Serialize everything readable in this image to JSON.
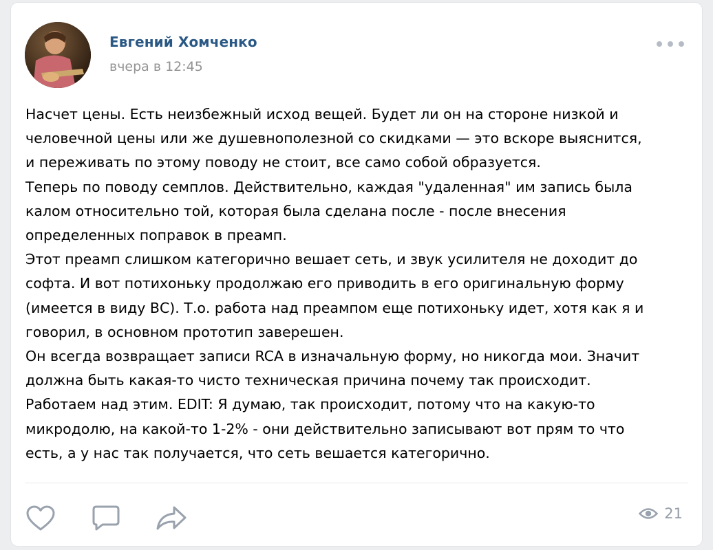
{
  "post": {
    "author": "Евгений Хомченко",
    "time": "вчера в 12:45",
    "lines": [
      "Насчет цены. Есть неизбежный исход вещей. Будет ли он на стороне низкой и",
      "человечной цены или же душевнополезной со скидками — это вскоре выяснится,",
      "и переживать по этому поводу не стоит, все само собой образуется.",
      "Теперь по поводу семплов. Действительно, каждая \"удаленная\" им запись была",
      "калом относительно той, которая была сделана после - после внесения",
      "определенных поправок в преамп.",
      "Этот преамп слишком категорично вешает сеть, и звук усилителя не доходит до",
      "софта. И вот потихоньку продолжаю его приводить в его оригинальную форму",
      "(имеется в виду ВС). Т.о. работа над преампом еще потихоньку идет, хотя как я и",
      "говорил, в основном прототип заверешен.",
      "Он всегда возвращает записи RCA в изначальную форму, но никогда мои. Значит",
      "должна быть какая-то чисто техническая причина почему так происходит.",
      "Работаем над этим. EDIT: Я думаю, так происходит, потому что на какую-то",
      "микродолю, на какой-то 1-2% - они действительно записывают вот прям то что",
      "есть, а у нас так получается, что сеть вешается категорично."
    ]
  },
  "actions": {
    "like_icon": "heart-icon",
    "comment_icon": "comment-icon",
    "share_icon": "share-icon"
  },
  "views": {
    "icon": "eye-icon",
    "count": "21"
  },
  "colors": {
    "author": "#2a5885",
    "meta": "#939393",
    "icon": "#99a2ad"
  }
}
